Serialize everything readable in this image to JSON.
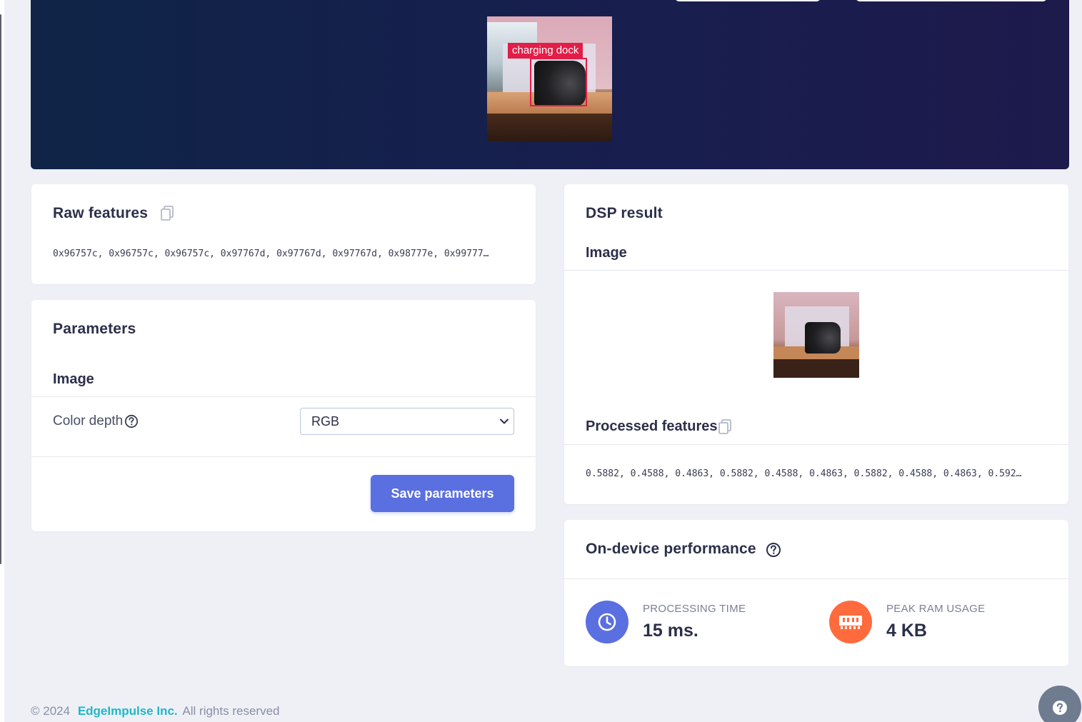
{
  "hero": {
    "bounding_box_label": "charging dock"
  },
  "raw_features": {
    "title": "Raw features",
    "values": "0x96757c, 0x96757c, 0x96757c, 0x97767d, 0x97767d, 0x97767d, 0x98777e, 0x99777…"
  },
  "parameters": {
    "title": "Parameters",
    "section": "Image",
    "color_depth_label": "Color depth",
    "color_depth_value": "RGB",
    "save_label": "Save parameters"
  },
  "dsp_result": {
    "title": "DSP result",
    "section": "Image",
    "processed_title": "Processed features",
    "processed_values": "0.5882, 0.4588, 0.4863, 0.5882, 0.4588, 0.4863, 0.5882, 0.4588, 0.4863, 0.592…"
  },
  "performance": {
    "title": "On-device performance",
    "processing_label": "PROCESSING TIME",
    "processing_value": "15 ms.",
    "ram_label": "PEAK RAM USAGE",
    "ram_value": "4 KB"
  },
  "footer": {
    "copyright": "© 2024",
    "brand": "EdgeImpulse Inc.",
    "rights": "All rights reserved"
  },
  "colors": {
    "accent": "#5a6fe0",
    "ram_icon_bg": "#ff6b3d",
    "brand_link": "#1fb8c8",
    "bbox": "#e21d48"
  },
  "icons": [
    "copy-icon",
    "help-circle-icon",
    "chevron-down-icon",
    "clock-icon",
    "memory-chip-icon",
    "question-icon"
  ]
}
